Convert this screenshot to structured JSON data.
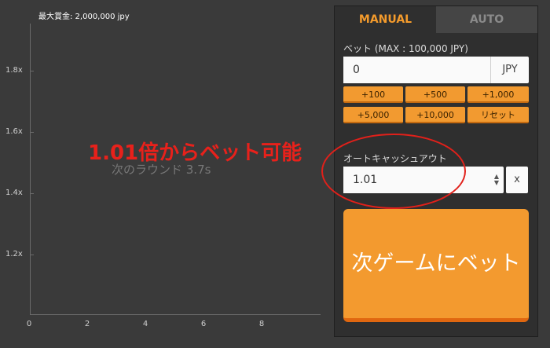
{
  "chart": {
    "max_win": "最大賞金: 2,000,000 jpy",
    "y_ticks": [
      "1.8x",
      "1.6x",
      "1.4x",
      "1.2x"
    ],
    "x_ticks": [
      "0",
      "2",
      "4",
      "6",
      "8"
    ],
    "next_round": "次のラウンド 3.7s"
  },
  "annotation": {
    "text": "1.01倍からベット可能",
    "color": "#e8211b"
  },
  "panel": {
    "tabs": [
      "MANUAL",
      "AUTO"
    ],
    "active_tab": "MANUAL",
    "bet_label": "ベット (MAX : 100,000 JPY)",
    "bet_value": "0",
    "bet_unit": "JPY",
    "quick_buttons": [
      "+100",
      "+500",
      "+1,000",
      "+5,000",
      "+10,000",
      "リセット"
    ],
    "autocash_label": "オートキャッシュアウト",
    "autocash_value": "1.01",
    "autocash_unit": "x",
    "bet_button": "次ゲームにベット"
  },
  "colors": {
    "accent": "#f39a2f",
    "background": "#3a3a3a",
    "panel": "#2f2f2f"
  }
}
